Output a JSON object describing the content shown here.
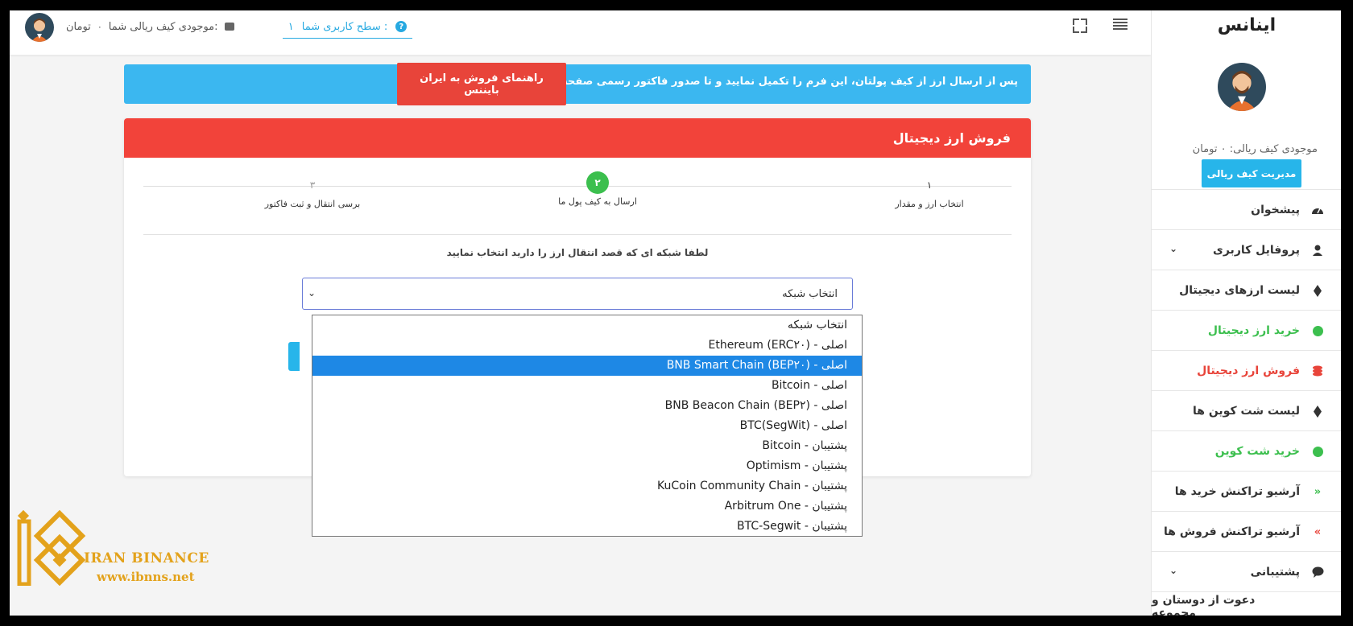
{
  "topbar": {
    "wallet_label": "موجودی کیف ریالی شما:",
    "wallet_amount": "۰",
    "wallet_unit": "تومان",
    "level_label": "سطح کاربری شما :",
    "level_value": "۱"
  },
  "sidebar": {
    "brand": "اینانس",
    "wallet_text": "موجودی کیف ریالی: ۰ تومان",
    "manage_button": "مدیریت کیف ریالی",
    "items": [
      {
        "label": "پیشخوان",
        "icon": "dashboard-icon"
      },
      {
        "label": "پروفایل کاربری",
        "icon": "user-icon"
      },
      {
        "label": "لیست ارزهای دیجیتال",
        "icon": "ethereum-icon"
      },
      {
        "label": "خرید ارز دیجیتال",
        "icon": "buy-coin-icon",
        "color": "#3cbf4e"
      },
      {
        "label": "فروش ارز دیجیتال",
        "icon": "coins-stack-icon",
        "color": "#e8443a"
      },
      {
        "label": "لیست شت کوین ها",
        "icon": "ethereum-icon"
      },
      {
        "label": "خرید شت کوین",
        "icon": "buy-coin-icon",
        "color": "#3cbf4e"
      },
      {
        "label": "آرشیو تراکنش خرید ها",
        "icon": "double-chevron-down-icon"
      },
      {
        "label": "آرشیو تراکنش فروش ها",
        "icon": "double-chevron-up-icon"
      },
      {
        "label": "پشتیبانی",
        "icon": "chat-icon"
      },
      {
        "label": "دعوت از دوستان و مجموعه",
        "icon": ""
      }
    ]
  },
  "banner": {
    "text": "پس از ارسال ارز از کیف پولتان، این فرم را تکمیل نمایید و تا صدور فاکتور رسمی صفحه را ترک ننمایید.",
    "guide_button": "راهنمای فروش به ایران بایننس"
  },
  "card": {
    "title": "فروش ارز دیجیتال",
    "steps": [
      {
        "num": "۱",
        "label": "انتخاب ارز و مقدار"
      },
      {
        "num": "۲",
        "label": "ارسال به کیف پول ما"
      },
      {
        "num": "۳",
        "label": "برسی انتقال و ثبت فاکتور"
      }
    ],
    "prompt": "لطفا شبکه ای که قصد انتقال ارز را دارید انتخاب نمایید",
    "select_value": "انتخاب شبکه"
  },
  "dropdown": {
    "selected_index": 2,
    "options": [
      "انتخاب شبکه",
      "Ethereum (ERC۲۰) - اصلی",
      "BNB Smart Chain (BEP۲۰) - اصلی",
      "Bitcoin - اصلی",
      "BNB Beacon Chain (BEP۲) - اصلی",
      "BTC(SegWit) - اصلی",
      "Bitcoin - پشتیبان",
      "Optimism - پشتیبان",
      "KuCoin Community Chain - پشتیبان",
      "Arbitrum One - پشتیبان",
      "BTC-Segwit - پشتیبان"
    ]
  },
  "watermark": {
    "name": "IRAN BINANCE",
    "url": "www.ibnns.net"
  },
  "colors": {
    "accent_blue": "#27b5ea",
    "header_red": "#f2433a",
    "success_green": "#3cbf4e",
    "logo_gold": "#e3a21b"
  }
}
